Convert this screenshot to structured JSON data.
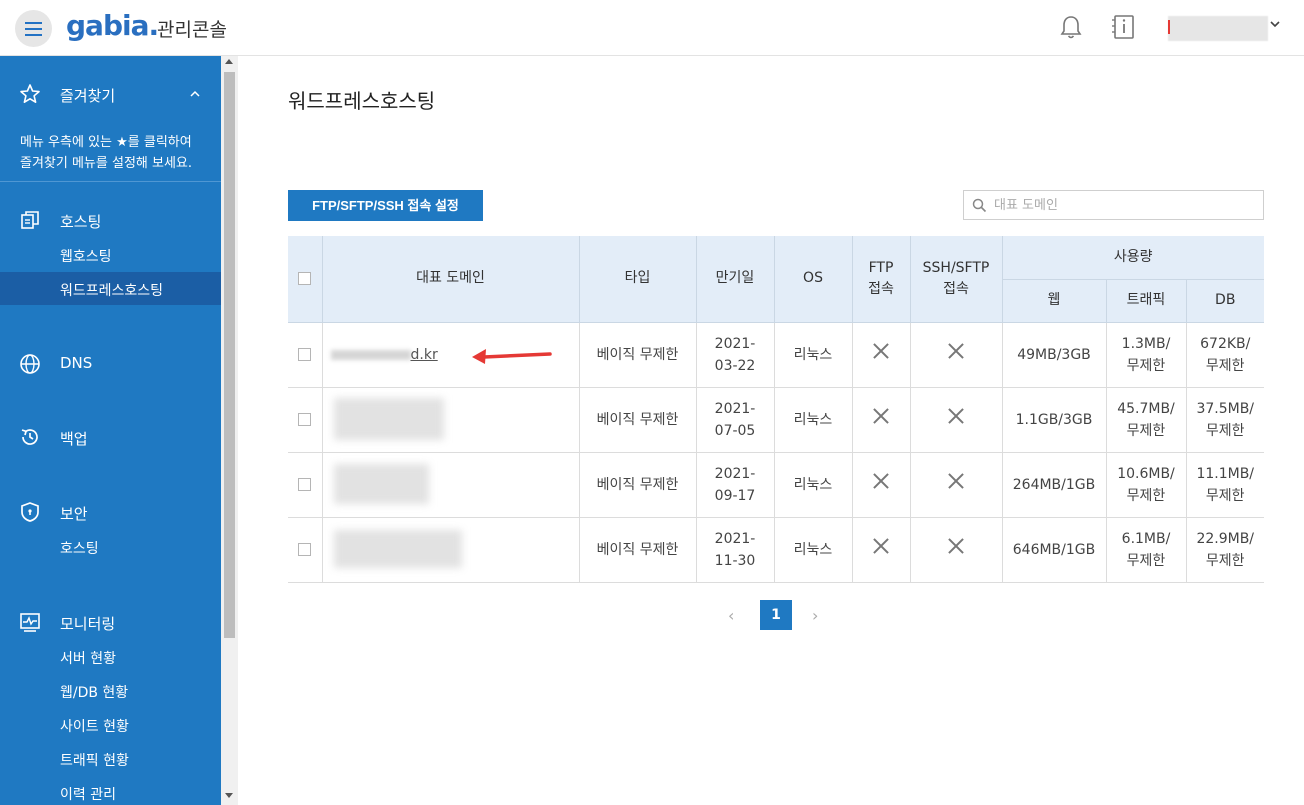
{
  "header": {
    "logo": "gabia.",
    "subtitle": "관리콘솔"
  },
  "sidebar": {
    "favorites": {
      "title": "즐겨찾기",
      "description_line1": "메뉴 우측에 있는 ★를 클릭하여",
      "description_line2": "즐겨찾기 메뉴를 설정해 보세요."
    },
    "sections": [
      {
        "title": "호스팅",
        "items": [
          "웹호스팅",
          "워드프레스호스팅"
        ]
      },
      {
        "title": "DNS",
        "items": []
      },
      {
        "title": "백업",
        "items": []
      },
      {
        "title": "보안",
        "items": [
          "호스팅"
        ]
      },
      {
        "title": "모니터링",
        "items": [
          "서버 현황",
          "웹/DB 현황",
          "사이트 현황",
          "트래픽 현황",
          "이력 관리"
        ]
      }
    ]
  },
  "main": {
    "title": "워드프레스호스팅",
    "ftp_button": "FTP/SFTP/SSH 접속 설정",
    "search_placeholder": "대표 도메인",
    "table": {
      "headers": {
        "domain": "대표 도메인",
        "type": "타입",
        "expire": "만기일",
        "os": "OS",
        "ftp_line1": "FTP",
        "ftp_line2": "접속",
        "ssh_line1": "SSH/SFTP",
        "ssh_line2": "접속",
        "usage": "사용량",
        "web": "웹",
        "traffic": "트래픽",
        "db": "DB"
      },
      "rows": [
        {
          "domain": "d.kr",
          "type": "베이직 무제한",
          "expire1": "2021-",
          "expire2": "03-22",
          "os": "리눅스",
          "web": "49MB/3GB",
          "traffic1": "1.3MB/",
          "traffic2": "무제한",
          "db1": "672KB/",
          "db2": "무제한"
        },
        {
          "domain": "",
          "type": "베이직 무제한",
          "expire1": "2021-",
          "expire2": "07-05",
          "os": "리눅스",
          "web": "1.1GB/3GB",
          "traffic1": "45.7MB/",
          "traffic2": "무제한",
          "db1": "37.5MB/",
          "db2": "무제한"
        },
        {
          "domain": "",
          "type": "베이직 무제한",
          "expire1": "2021-",
          "expire2": "09-17",
          "os": "리눅스",
          "web": "264MB/1GB",
          "traffic1": "10.6MB/",
          "traffic2": "무제한",
          "db1": "11.1MB/",
          "db2": "무제한"
        },
        {
          "domain": "",
          "type": "베이직 무제한",
          "expire1": "2021-",
          "expire2": "11-30",
          "os": "리눅스",
          "web": "646MB/1GB",
          "traffic1": "6.1MB/",
          "traffic2": "무제한",
          "db1": "22.9MB/",
          "db2": "무제한"
        }
      ]
    },
    "pagination": {
      "current": "1",
      "prev": "‹",
      "next": "›"
    }
  },
  "colors": {
    "brand": "#1f79c2",
    "active": "#1b5ea5",
    "expire_red": "#e3632a",
    "header_bg": "#e3edf8"
  }
}
